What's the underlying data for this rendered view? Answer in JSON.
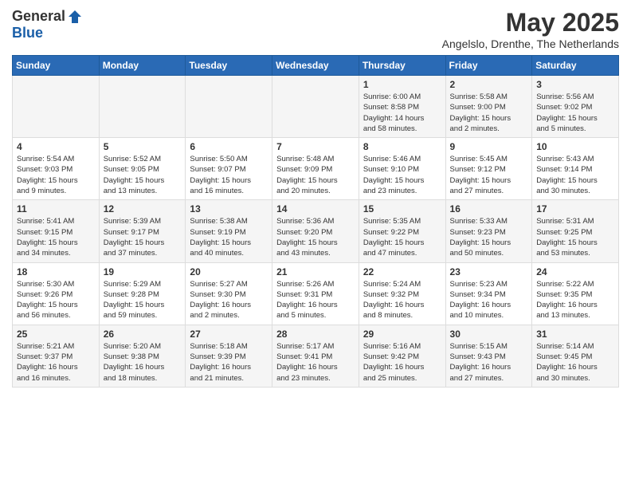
{
  "header": {
    "logo_general": "General",
    "logo_blue": "Blue",
    "month_title": "May 2025",
    "location": "Angelslo, Drenthe, The Netherlands"
  },
  "weekdays": [
    "Sunday",
    "Monday",
    "Tuesday",
    "Wednesday",
    "Thursday",
    "Friday",
    "Saturday"
  ],
  "weeks": [
    [
      {
        "day": "",
        "info": ""
      },
      {
        "day": "",
        "info": ""
      },
      {
        "day": "",
        "info": ""
      },
      {
        "day": "",
        "info": ""
      },
      {
        "day": "1",
        "info": "Sunrise: 6:00 AM\nSunset: 8:58 PM\nDaylight: 14 hours\nand 58 minutes."
      },
      {
        "day": "2",
        "info": "Sunrise: 5:58 AM\nSunset: 9:00 PM\nDaylight: 15 hours\nand 2 minutes."
      },
      {
        "day": "3",
        "info": "Sunrise: 5:56 AM\nSunset: 9:02 PM\nDaylight: 15 hours\nand 5 minutes."
      }
    ],
    [
      {
        "day": "4",
        "info": "Sunrise: 5:54 AM\nSunset: 9:03 PM\nDaylight: 15 hours\nand 9 minutes."
      },
      {
        "day": "5",
        "info": "Sunrise: 5:52 AM\nSunset: 9:05 PM\nDaylight: 15 hours\nand 13 minutes."
      },
      {
        "day": "6",
        "info": "Sunrise: 5:50 AM\nSunset: 9:07 PM\nDaylight: 15 hours\nand 16 minutes."
      },
      {
        "day": "7",
        "info": "Sunrise: 5:48 AM\nSunset: 9:09 PM\nDaylight: 15 hours\nand 20 minutes."
      },
      {
        "day": "8",
        "info": "Sunrise: 5:46 AM\nSunset: 9:10 PM\nDaylight: 15 hours\nand 23 minutes."
      },
      {
        "day": "9",
        "info": "Sunrise: 5:45 AM\nSunset: 9:12 PM\nDaylight: 15 hours\nand 27 minutes."
      },
      {
        "day": "10",
        "info": "Sunrise: 5:43 AM\nSunset: 9:14 PM\nDaylight: 15 hours\nand 30 minutes."
      }
    ],
    [
      {
        "day": "11",
        "info": "Sunrise: 5:41 AM\nSunset: 9:15 PM\nDaylight: 15 hours\nand 34 minutes."
      },
      {
        "day": "12",
        "info": "Sunrise: 5:39 AM\nSunset: 9:17 PM\nDaylight: 15 hours\nand 37 minutes."
      },
      {
        "day": "13",
        "info": "Sunrise: 5:38 AM\nSunset: 9:19 PM\nDaylight: 15 hours\nand 40 minutes."
      },
      {
        "day": "14",
        "info": "Sunrise: 5:36 AM\nSunset: 9:20 PM\nDaylight: 15 hours\nand 43 minutes."
      },
      {
        "day": "15",
        "info": "Sunrise: 5:35 AM\nSunset: 9:22 PM\nDaylight: 15 hours\nand 47 minutes."
      },
      {
        "day": "16",
        "info": "Sunrise: 5:33 AM\nSunset: 9:23 PM\nDaylight: 15 hours\nand 50 minutes."
      },
      {
        "day": "17",
        "info": "Sunrise: 5:31 AM\nSunset: 9:25 PM\nDaylight: 15 hours\nand 53 minutes."
      }
    ],
    [
      {
        "day": "18",
        "info": "Sunrise: 5:30 AM\nSunset: 9:26 PM\nDaylight: 15 hours\nand 56 minutes."
      },
      {
        "day": "19",
        "info": "Sunrise: 5:29 AM\nSunset: 9:28 PM\nDaylight: 15 hours\nand 59 minutes."
      },
      {
        "day": "20",
        "info": "Sunrise: 5:27 AM\nSunset: 9:30 PM\nDaylight: 16 hours\nand 2 minutes."
      },
      {
        "day": "21",
        "info": "Sunrise: 5:26 AM\nSunset: 9:31 PM\nDaylight: 16 hours\nand 5 minutes."
      },
      {
        "day": "22",
        "info": "Sunrise: 5:24 AM\nSunset: 9:32 PM\nDaylight: 16 hours\nand 8 minutes."
      },
      {
        "day": "23",
        "info": "Sunrise: 5:23 AM\nSunset: 9:34 PM\nDaylight: 16 hours\nand 10 minutes."
      },
      {
        "day": "24",
        "info": "Sunrise: 5:22 AM\nSunset: 9:35 PM\nDaylight: 16 hours\nand 13 minutes."
      }
    ],
    [
      {
        "day": "25",
        "info": "Sunrise: 5:21 AM\nSunset: 9:37 PM\nDaylight: 16 hours\nand 16 minutes."
      },
      {
        "day": "26",
        "info": "Sunrise: 5:20 AM\nSunset: 9:38 PM\nDaylight: 16 hours\nand 18 minutes."
      },
      {
        "day": "27",
        "info": "Sunrise: 5:18 AM\nSunset: 9:39 PM\nDaylight: 16 hours\nand 21 minutes."
      },
      {
        "day": "28",
        "info": "Sunrise: 5:17 AM\nSunset: 9:41 PM\nDaylight: 16 hours\nand 23 minutes."
      },
      {
        "day": "29",
        "info": "Sunrise: 5:16 AM\nSunset: 9:42 PM\nDaylight: 16 hours\nand 25 minutes."
      },
      {
        "day": "30",
        "info": "Sunrise: 5:15 AM\nSunset: 9:43 PM\nDaylight: 16 hours\nand 27 minutes."
      },
      {
        "day": "31",
        "info": "Sunrise: 5:14 AM\nSunset: 9:45 PM\nDaylight: 16 hours\nand 30 minutes."
      }
    ]
  ]
}
